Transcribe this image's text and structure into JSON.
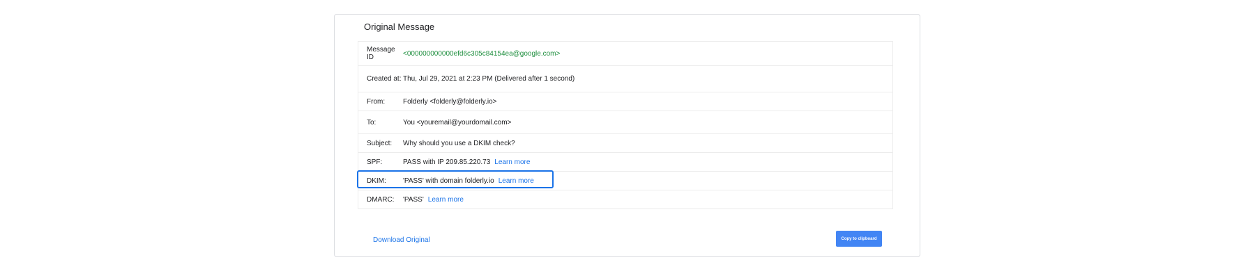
{
  "title": "Original Message",
  "rows": [
    {
      "label": "Message ID",
      "value": "<000000000000efd6c305c84154ea@google.com>"
    },
    {
      "label": "Created at:",
      "value": "Thu, Jul 29, 2021 at 2:23 PM (Delivered after 1 second)"
    },
    {
      "label": "From:",
      "value": "Folderly <folderly@folderly.io>"
    },
    {
      "label": "To:",
      "value": "You <youremail@yourdomail.com>"
    },
    {
      "label": "Subject:",
      "value": "Why should you use a DKIM check?"
    },
    {
      "label": "SPF:",
      "value": "PASS with IP 209.85.220.73",
      "link": "Learn more"
    },
    {
      "label": "DKIM:",
      "value": "'PASS' with domain folderly.io",
      "link": "Learn more"
    },
    {
      "label": "DMARC:",
      "value": "'PASS'",
      "link": "Learn more"
    }
  ],
  "footer": {
    "download_label": "Download Original",
    "copy_label": "Copy to clipboard"
  },
  "colors": {
    "accent": "#1a73e8",
    "button": "#4285f4",
    "message_id": "#1e8e3e"
  }
}
